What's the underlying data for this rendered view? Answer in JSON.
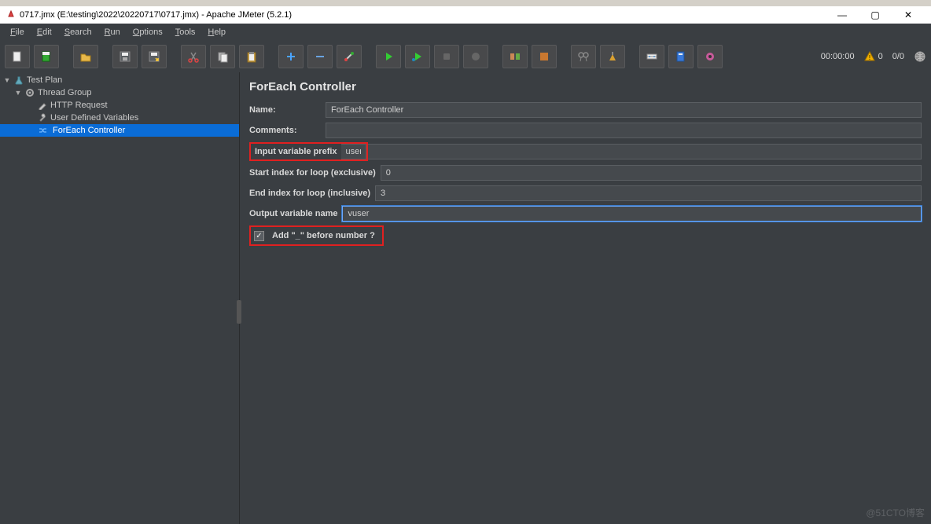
{
  "window": {
    "title": "0717.jmx (E:\\testing\\2022\\20220717\\0717.jmx) - Apache JMeter (5.2.1)",
    "controls": {
      "min": "—",
      "max": "▢",
      "close": "✕"
    }
  },
  "menu": {
    "file": "File",
    "edit": "Edit",
    "search": "Search",
    "run": "Run",
    "options": "Options",
    "tools": "Tools",
    "help": "Help"
  },
  "toolbar": {
    "btns": [
      "📄",
      "📂",
      "💾",
      "📥",
      "",
      "✂",
      "📋",
      "📃",
      "",
      "➕",
      "➖",
      "🧹",
      "",
      "▶",
      "▶",
      "⏹",
      "⏹",
      "",
      "🧰",
      "🔧",
      "🔍",
      "🧽",
      "",
      "📑",
      "📘",
      "🎛"
    ],
    "time": "00:00:00",
    "warn_count": "0",
    "thread_status": "0/0"
  },
  "tree": {
    "items": [
      {
        "label": "Test Plan",
        "icon": "flask-icon",
        "indent": 0,
        "expandable": true
      },
      {
        "label": "Thread Group",
        "icon": "gear-icon",
        "indent": 1,
        "expandable": true
      },
      {
        "label": "HTTP Request",
        "icon": "pencil-icon",
        "indent": 2,
        "expandable": false
      },
      {
        "label": "User Defined Variables",
        "icon": "wrench-icon",
        "indent": 2,
        "expandable": false
      },
      {
        "label": "ForEach Controller",
        "icon": "shuffle-icon",
        "indent": 2,
        "expandable": false,
        "selected": true
      }
    ]
  },
  "editor": {
    "title": "ForEach Controller",
    "name_label": "Name:",
    "name_value": "ForEach Controller",
    "comments_label": "Comments:",
    "comments_value": "",
    "prefix_label": "Input variable prefix",
    "prefix_value": "user",
    "start_label": "Start index for loop (exclusive)",
    "start_value": "0",
    "end_label": "End index for loop (inclusive)",
    "end_value": "3",
    "output_label": "Output variable name",
    "output_value": "vuser",
    "addunderscore_label": "Add \"_\" before number ?"
  },
  "watermark": "@51CTO博客"
}
